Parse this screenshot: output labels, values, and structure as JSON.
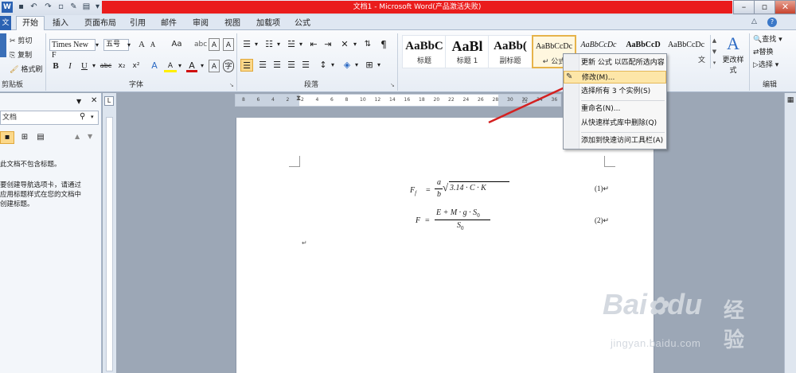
{
  "window": {
    "title": "文档1 - Microsoft Word(产品激活失败)"
  },
  "tabs": [
    "开始",
    "插入",
    "页面布局",
    "引用",
    "邮件",
    "审阅",
    "视图",
    "加载项",
    "公式"
  ],
  "clipboard": {
    "cut": "剪切",
    "copy": "复制",
    "format_painter": "格式刷",
    "group": "剪贴板"
  },
  "font": {
    "name": "Times New F",
    "size": "五号",
    "group": "字体",
    "grow": "A",
    "shrink": "A",
    "clear": "Aa",
    "bold": "B",
    "italic": "I",
    "underline": "U",
    "strike": "abc",
    "subscript": "x₂",
    "superscript": "x²",
    "highlight": "A"
  },
  "paragraph": {
    "group": "段落"
  },
  "styles": [
    {
      "preview": "AaBbC",
      "name": "标题"
    },
    {
      "preview": "AaBl",
      "name": "标题 1"
    },
    {
      "preview": "AaBb(",
      "name": "副标题"
    },
    {
      "preview": "AaBbCcDc",
      "name": "↵ 公式"
    },
    {
      "preview": "AaBbCcDc",
      "name": ""
    },
    {
      "preview": "AaBbCcD",
      "name": ""
    },
    {
      "preview": "AaBbCcDc",
      "name": "文"
    }
  ],
  "change_styles": "更改样式",
  "editing": {
    "find": "查找",
    "replace": "替换",
    "select": "选择",
    "group": "编辑"
  },
  "context_menu": {
    "update": "更新 公式 以匹配所选内容(P)",
    "modify": "修改(M)...",
    "select_all": "选择所有 3 个实例(S)",
    "rename": "重命名(N)...",
    "remove": "从快速样式库中删除(Q)",
    "add_qat": "添加到快速访问工具栏(A)"
  },
  "nav": {
    "search_placeholder": "文档",
    "msg1": "此文档不包含标题。",
    "msg2": "要创建导航选项卡，请通过应用标题样式在您的文档中创建标题。",
    "msg2a": "要创建导航选项卡，请通过",
    "msg2b": "应用标题样式在您的文档中",
    "msg2c": "创建标题。"
  },
  "ruler_ticks": [
    "8",
    "6",
    "4",
    "2",
    "2",
    "4",
    "6",
    "8",
    "10",
    "12",
    "14",
    "16",
    "18",
    "20",
    "22",
    "24",
    "26",
    "28",
    "30",
    "32",
    "34",
    "36",
    "38"
  ],
  "equations": [
    {
      "lhs": "F",
      "sub": "f",
      "eq": "=",
      "num": "a",
      "den": "b",
      "sqrt": "3.14 · C · K",
      "number": "(1)↵"
    },
    {
      "lhs": "F",
      "eq": "=",
      "num": "E + M · g · S",
      "numsub": "0",
      "den": "S",
      "densub": "0",
      "number": "(2)↵"
    }
  ],
  "para_mark": "↵",
  "watermark": {
    "brand": "Bai",
    "brand2": "du",
    "cn": "经验",
    "url": "jingyan.baidu.com"
  }
}
